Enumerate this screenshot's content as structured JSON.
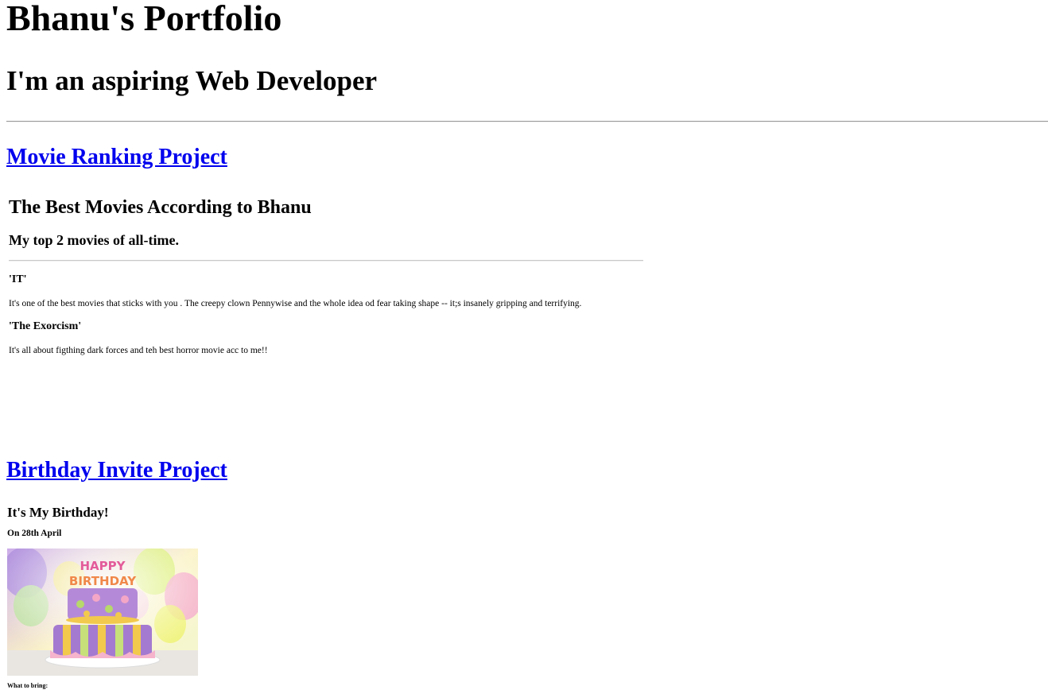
{
  "header": {
    "title": "Bhanu's Portfolio",
    "subtitle": "I'm an aspiring Web Developer"
  },
  "projects": {
    "movie": {
      "link_label": "Movie Ranking Project",
      "embed": {
        "heading": "The Best Movies According to Bhanu",
        "subheading": "My top 2 movies of all-time.",
        "movies": [
          {
            "title": "'IT'",
            "description": "It's one of the best movies that sticks with you . The creepy clown Pennywise and the whole idea od fear taking shape -- it;s insanely gripping and terrifying."
          },
          {
            "title": "'The Exorcism'",
            "description": "It's all about figthing dark forces and teh best horror movie acc to me!!"
          }
        ]
      }
    },
    "birthday": {
      "link_label": "Birthday Invite Project",
      "heading": "It's My Birthday!",
      "date_line": "On 28th April",
      "bring_label": "What to bring:"
    }
  },
  "image_text": {
    "banner_word_1": "HAPPY",
    "banner_word_2": "BIRTHDAY"
  },
  "colors": {
    "link": "#0000ee",
    "text": "#000000",
    "divider": "#9a9a9a"
  }
}
